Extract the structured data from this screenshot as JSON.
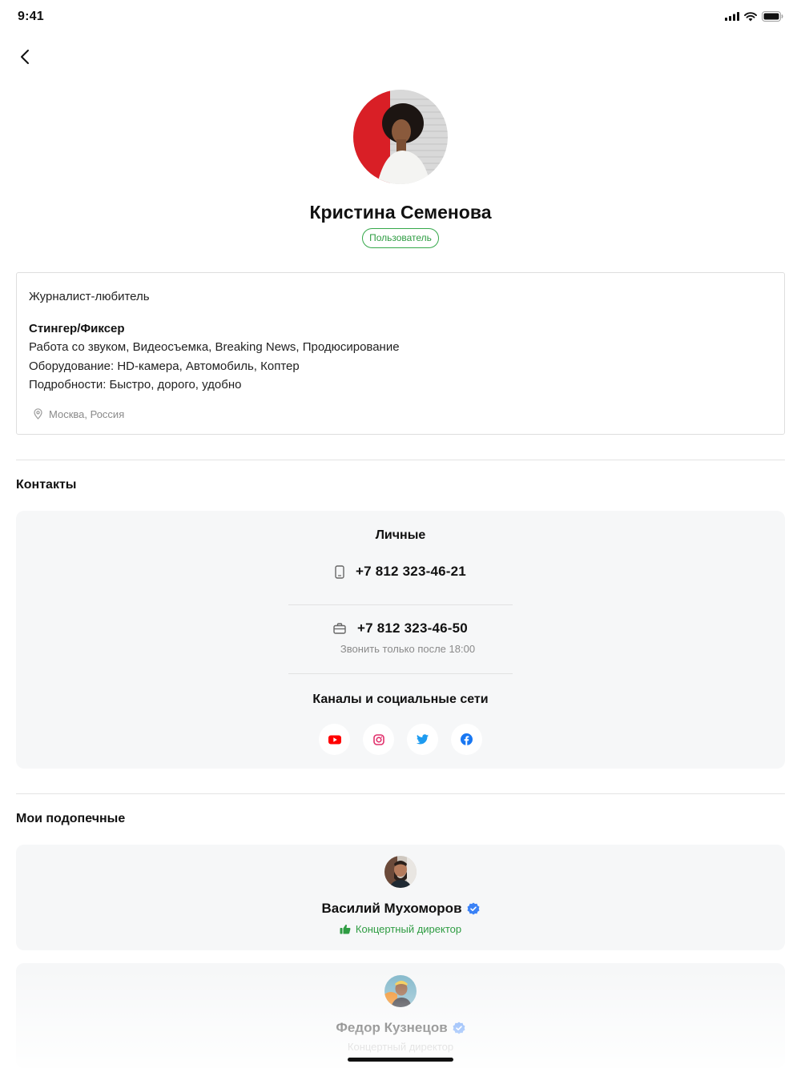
{
  "status_bar": {
    "time": "9:41"
  },
  "profile": {
    "name": "Кристина Семенова",
    "role_badge": "Пользователь"
  },
  "about": {
    "tagline": "Журналист-любитель",
    "title": "Стингер/Фиксер",
    "skills": "Работа со звуком, Видеосъемка, Breaking News, Продюсирование",
    "equipment": "Оборудование: HD-камера, Автомобиль, Коптер",
    "details": "Подробности: Быстро, дорого, удобно",
    "location": "Москва, Россия"
  },
  "contacts": {
    "section_title": "Контакты",
    "personal_heading": "Личные",
    "mobile_phone": "+7 812 323-46-21",
    "work_phone": "+7 812 323-46-50",
    "work_phone_note": "Звонить только после 18:00",
    "socials_heading": "Каналы и социальные сети",
    "socials": [
      {
        "icon": "youtube-icon",
        "color": "#ff0000"
      },
      {
        "icon": "instagram-icon",
        "color": "#e1306c"
      },
      {
        "icon": "twitter-icon",
        "color": "#1d9bf0"
      },
      {
        "icon": "facebook-icon",
        "color": "#1877f2"
      }
    ]
  },
  "wards": {
    "section_title": "Мои подопечные",
    "items": [
      {
        "name": "Василий Мухоморов",
        "role": "Концертный директор",
        "verified": true,
        "liked": true
      },
      {
        "name": "Федор Кузнецов",
        "role": "Концертный директор",
        "verified": true,
        "liked": false
      }
    ]
  },
  "colors": {
    "accent_green": "#35a84a",
    "verified_blue": "#3b82f6",
    "card_background": "#f6f7f8"
  }
}
